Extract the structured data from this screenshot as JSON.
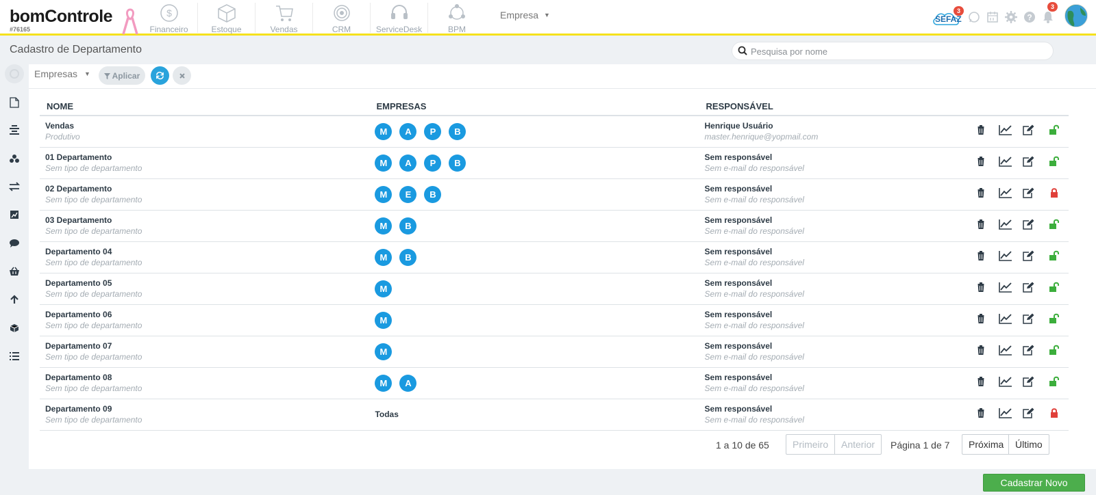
{
  "app": {
    "brand": "bomControle",
    "account_id": "#76165",
    "modules": [
      {
        "label": "Financeiro",
        "icon": "dollar-icon"
      },
      {
        "label": "Estoque",
        "icon": "box-icon"
      },
      {
        "label": "Vendas",
        "icon": "cart-icon"
      },
      {
        "label": "CRM",
        "icon": "target-icon"
      },
      {
        "label": "ServiceDesk",
        "icon": "headset-icon"
      },
      {
        "label": "BPM",
        "icon": "network-icon"
      }
    ],
    "empresa_select": "Empresa",
    "sefaz_label": "SEFAZ",
    "sefaz_badge": "3",
    "notif_badge": "3"
  },
  "page": {
    "title": "Cadastro de Departamento",
    "search_placeholder": "Pesquisa por nome"
  },
  "filter": {
    "empresas_label": "Empresas",
    "aplicar_label": "Aplicar"
  },
  "table": {
    "headers": {
      "nome": "NOME",
      "empresas": "EMPRESAS",
      "responsavel": "RESPONSÁVEL"
    },
    "rows": [
      {
        "name": "Vendas",
        "type": "Produtivo",
        "companies": [
          "M",
          "A",
          "P",
          "B"
        ],
        "resp_name": "Henrique Usuário",
        "resp_email": "master.henrique@yopmail.com",
        "lock": "open"
      },
      {
        "name": "01 Departamento",
        "type": "Sem tipo de departamento",
        "companies": [
          "M",
          "A",
          "P",
          "B"
        ],
        "resp_name": "Sem responsável",
        "resp_email": "Sem e-mail do responsável",
        "lock": "open"
      },
      {
        "name": "02 Departamento",
        "type": "Sem tipo de departamento",
        "companies": [
          "M",
          "E",
          "B"
        ],
        "resp_name": "Sem responsável",
        "resp_email": "Sem e-mail do responsável",
        "lock": "locked"
      },
      {
        "name": "03 Departamento",
        "type": "Sem tipo de departamento",
        "companies": [
          "M",
          "B"
        ],
        "resp_name": "Sem responsável",
        "resp_email": "Sem e-mail do responsável",
        "lock": "open"
      },
      {
        "name": "Departamento 04",
        "type": "Sem tipo de departamento",
        "companies": [
          "M",
          "B"
        ],
        "resp_name": "Sem responsável",
        "resp_email": "Sem e-mail do responsável",
        "lock": "open"
      },
      {
        "name": "Departamento 05",
        "type": "Sem tipo de departamento",
        "companies": [
          "M"
        ],
        "resp_name": "Sem responsável",
        "resp_email": "Sem e-mail do responsável",
        "lock": "open"
      },
      {
        "name": "Departamento 06",
        "type": "Sem tipo de departamento",
        "companies": [
          "M"
        ],
        "resp_name": "Sem responsável",
        "resp_email": "Sem e-mail do responsável",
        "lock": "open"
      },
      {
        "name": "Departamento 07",
        "type": "Sem tipo de departamento",
        "companies": [
          "M"
        ],
        "resp_name": "Sem responsável",
        "resp_email": "Sem e-mail do responsável",
        "lock": "open"
      },
      {
        "name": "Departamento 08",
        "type": "Sem tipo de departamento",
        "companies": [
          "M",
          "A"
        ],
        "resp_name": "Sem responsável",
        "resp_email": "Sem e-mail do responsável",
        "lock": "open"
      },
      {
        "name": "Departamento 09",
        "type": "Sem tipo de departamento",
        "companies": [],
        "companies_text": "Todas",
        "resp_name": "Sem responsável",
        "resp_email": "Sem e-mail do responsável",
        "lock": "locked"
      }
    ]
  },
  "pagination": {
    "range": "1 a 10 de 65",
    "first": "Primeiro",
    "prev": "Anterior",
    "page_info": "Página 1 de 7",
    "next": "Próxima",
    "last": "Último"
  },
  "actions": {
    "new_label": "Cadastrar Novo"
  },
  "colors": {
    "accent_yellow": "#f5e11c",
    "chip_blue": "#1a9ae0",
    "unlock_green": "#3cae3c",
    "lock_red": "#e0403a",
    "new_button": "#4cae4c"
  }
}
